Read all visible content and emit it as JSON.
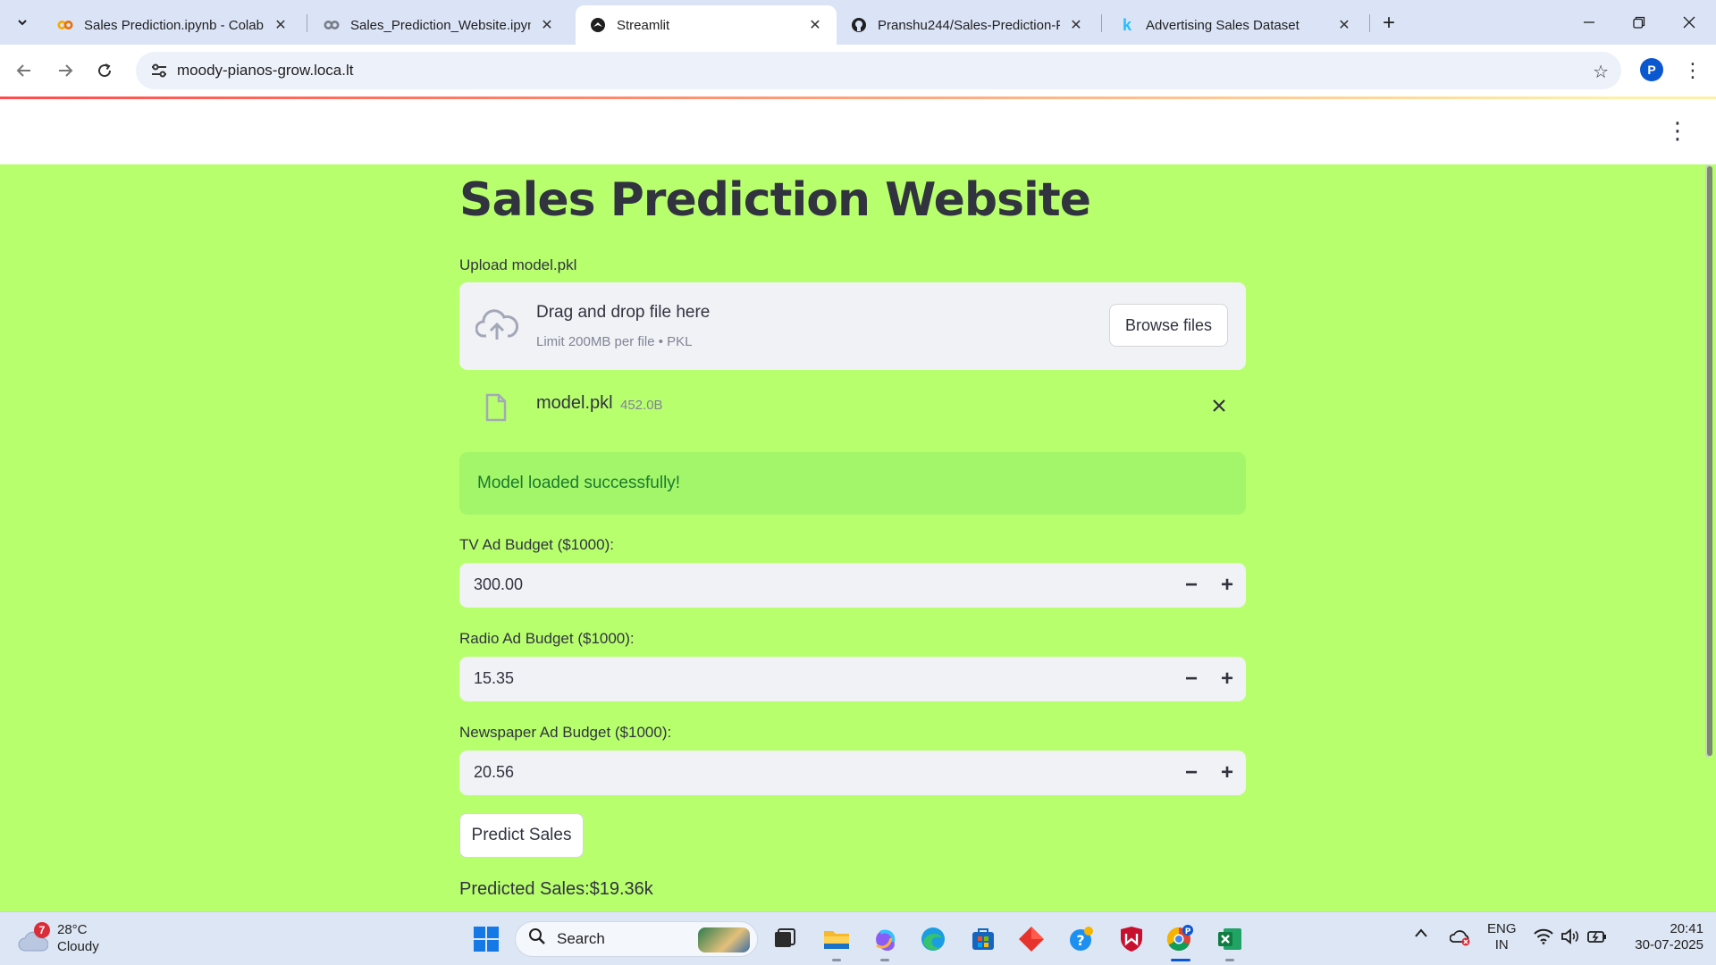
{
  "browser": {
    "tabs": [
      {
        "title": "Sales Prediction.ipynb - Colab",
        "icon": "colab-icon",
        "active": false
      },
      {
        "title": "Sales_Prediction_Website.ipynb",
        "icon": "colab-icon",
        "active": false
      },
      {
        "title": "Streamlit",
        "icon": "streamlit-icon",
        "active": true
      },
      {
        "title": "Pranshu244/Sales-Prediction-P",
        "icon": "github-icon",
        "active": false
      },
      {
        "title": "Advertising Sales Dataset",
        "icon": "kaggle-icon",
        "active": false
      }
    ],
    "url": "moody-pianos-grow.loca.lt",
    "profile_initial": "P"
  },
  "app": {
    "title": "Sales Prediction Website",
    "uploader": {
      "label": "Upload model.pkl",
      "drag_text": "Drag and drop file here",
      "limit_text": "Limit 200MB per file • PKL",
      "browse_label": "Browse files"
    },
    "file": {
      "name": "model.pkl",
      "size": "452.0B"
    },
    "success_message": "Model loaded successfully!",
    "inputs": [
      {
        "label": "TV Ad Budget ($1000):",
        "value": "300.00"
      },
      {
        "label": "Radio Ad Budget ($1000):",
        "value": "15.35"
      },
      {
        "label": "Newspaper Ad Budget ($1000):",
        "value": "20.56"
      }
    ],
    "predict_label": "Predict Sales",
    "result": "Predicted Sales:$19.36k"
  },
  "taskbar": {
    "weather": {
      "temp": "28°C",
      "condition": "Cloudy",
      "badge": "7"
    },
    "search_label": "Search",
    "lang": {
      "line1": "ENG",
      "line2": "IN"
    },
    "time": "20:41",
    "date": "30-07-2025",
    "profile_badge": "P"
  },
  "colors": {
    "page_bg": "#b8ff6e",
    "success_bg": "#a3f66a",
    "success_text": "#1b7b2f",
    "input_bg": "#f0f2f6",
    "text": "#31333f"
  }
}
